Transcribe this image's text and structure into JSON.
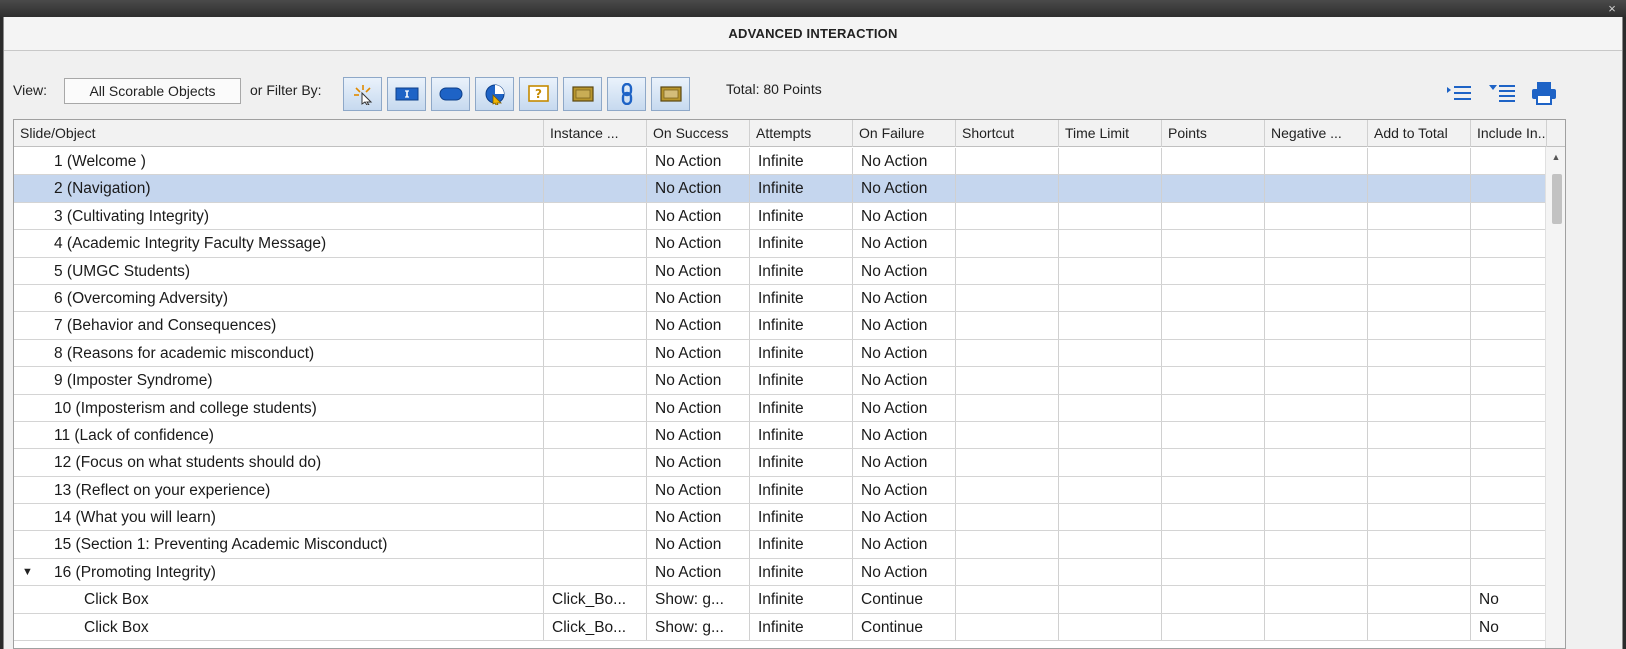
{
  "dialog": {
    "title": "ADVANCED INTERACTION",
    "close_glyph": "×"
  },
  "toolbar": {
    "view_label": "View:",
    "view_value": "All Scorable Objects",
    "filter_label": "or Filter By:",
    "filter_buttons": [
      "click-box-filter",
      "text-entry-filter",
      "button-filter",
      "drag-drop-filter",
      "question-filter",
      "smart-shape-filter",
      "hyperlink-filter",
      "rollover-filter"
    ],
    "total": "Total: 80 Points",
    "tools": [
      "expand-all-icon",
      "collapse-all-icon",
      "print-icon"
    ]
  },
  "columns": [
    "Slide/Object",
    "Instance ...",
    "On Success",
    "Attempts",
    "On Failure",
    "Shortcut",
    "Time Limit",
    "Points",
    "Negative ...",
    "Add to Total",
    "Include In..."
  ],
  "rows": [
    {
      "name": "1 (Welcome )",
      "instance": "",
      "success": "No Action",
      "attempts": "Infinite",
      "failure": "No Action",
      "include": ""
    },
    {
      "name": "2 (Navigation)",
      "instance": "",
      "success": "No Action",
      "attempts": "Infinite",
      "failure": "No Action",
      "include": ""
    },
    {
      "name": "3 (Cultivating Integrity)",
      "instance": "",
      "success": "No Action",
      "attempts": "Infinite",
      "failure": "No Action",
      "include": ""
    },
    {
      "name": "4 (Academic Integrity Faculty Message)",
      "instance": "",
      "success": "No Action",
      "attempts": "Infinite",
      "failure": "No Action",
      "include": ""
    },
    {
      "name": "5 (UMGC Students)",
      "instance": "",
      "success": "No Action",
      "attempts": "Infinite",
      "failure": "No Action",
      "include": ""
    },
    {
      "name": "6 (Overcoming Adversity)",
      "instance": "",
      "success": "No Action",
      "attempts": "Infinite",
      "failure": "No Action",
      "include": ""
    },
    {
      "name": "7 (Behavior and Consequences)",
      "instance": "",
      "success": "No Action",
      "attempts": "Infinite",
      "failure": "No Action",
      "include": ""
    },
    {
      "name": "8 (Reasons for academic misconduct)",
      "instance": "",
      "success": "No Action",
      "attempts": "Infinite",
      "failure": "No Action",
      "include": ""
    },
    {
      "name": "9 (Imposter Syndrome)",
      "instance": "",
      "success": "No Action",
      "attempts": "Infinite",
      "failure": "No Action",
      "include": ""
    },
    {
      "name": "10 (Imposterism and college students)",
      "instance": "",
      "success": "No Action",
      "attempts": "Infinite",
      "failure": "No Action",
      "include": ""
    },
    {
      "name": "11 (Lack of confidence)",
      "instance": "",
      "success": "No Action",
      "attempts": "Infinite",
      "failure": "No Action",
      "include": ""
    },
    {
      "name": "12 (Focus on what students should do)",
      "instance": "",
      "success": "No Action",
      "attempts": "Infinite",
      "failure": "No Action",
      "include": ""
    },
    {
      "name": "13 (Reflect on your experience)",
      "instance": "",
      "success": "No Action",
      "attempts": "Infinite",
      "failure": "No Action",
      "include": ""
    },
    {
      "name": "14 (What you will learn)",
      "instance": "",
      "success": "No Action",
      "attempts": "Infinite",
      "failure": "No Action",
      "include": ""
    },
    {
      "name": "15 (Section 1: Preventing Academic Misconduct)",
      "instance": "",
      "success": "No Action",
      "attempts": "Infinite",
      "failure": "No Action",
      "include": ""
    },
    {
      "name": "16 (Promoting Integrity)",
      "instance": "",
      "success": "No Action",
      "attempts": "Infinite",
      "failure": "No Action",
      "include": "",
      "expander": "▼"
    },
    {
      "name": "Click Box",
      "instance": "Click_Bo...",
      "success": "Show: g...",
      "attempts": "Infinite",
      "failure": "Continue",
      "include": "No"
    },
    {
      "name": "Click Box",
      "instance": "Click_Bo...",
      "success": "Show: g...",
      "attempts": "Infinite",
      "failure": "Continue",
      "include": "No"
    }
  ],
  "selected_row": "2 (Navigation)",
  "colors": {
    "selected": "#c5d6ee",
    "accent": "#2b5fa8"
  }
}
